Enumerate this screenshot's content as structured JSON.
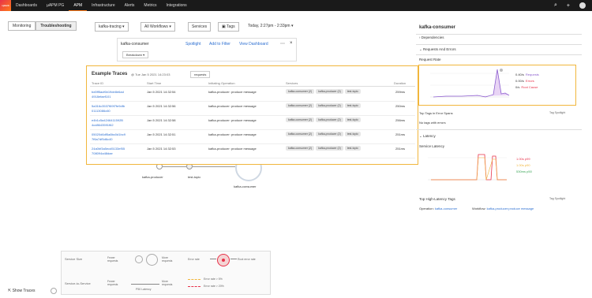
{
  "nav": {
    "logo": "splunk",
    "items": [
      "Dashboards",
      "µAPM PG",
      "APM",
      "Infrastructure",
      "Alerts",
      "Metrics",
      "Integrations"
    ],
    "active": "APM"
  },
  "toolbar": {
    "tabs": [
      "Monitoring",
      "Troubleshooting"
    ],
    "active_tab": "Troubleshooting",
    "service_filter": "kafka-tracing",
    "workflow_filter": "All Workflows",
    "services_btn": "Services",
    "tags_btn": "Tags",
    "time": "Today, 2:27pm - 2:33pm"
  },
  "service_panel": {
    "name": "kafka-consumer",
    "breakdown": "Breakdown",
    "links": [
      "Spotlight",
      "Add to Filter",
      "View Dashboard"
    ]
  },
  "traces": {
    "title": "Example Traces",
    "timestamp": "@ Tue Jan 5 2021 14:23:03",
    "requests_btn": "requests",
    "columns": [
      "Trace ID",
      "Start Time",
      "Initiating Operation",
      "Services",
      "Duration"
    ],
    "rows": [
      {
        "id1": "bd0ff5acf6b19de8e6ad",
        "id2": "4918efaef101",
        "start": "Jan 5 2021 14:32:54",
        "op": "kafka-producer: produce message",
        "dur": "259ms"
      },
      {
        "id1": "5a316c3537f69f7fe9dfb",
        "id2": "01113086c60",
        "start": "Jan 5 2021 14:32:56",
        "op": "kafka-producer: produce message",
        "dur": "250ms"
      },
      {
        "id1": "e4b1c5a4246411592B",
        "id2": "4cd8643591f62",
        "start": "Jan 5 2021 14:32:58",
        "op": "kafka-producer: produce message",
        "dur": "256ms"
      },
      {
        "id1": "05020d6df5a8bc0d1bc9",
        "id2": "7f6a7df5d6c40",
        "start": "Jan 5 2021 14:32:51",
        "op": "kafka-producer: produce message",
        "dur": "251ms"
      },
      {
        "id1": "24a0bf3a5ecd5133ef55",
        "id2": "708094a48dae",
        "start": "Jan 5 2021 14:32:53",
        "op": "kafka-producer: produce message",
        "dur": "251ms"
      }
    ],
    "services": [
      "kafka-consumer (2)",
      "kafka-producer (2)",
      "test-topic"
    ]
  },
  "map": {
    "nodes": [
      "kafka-producer",
      "test-topic",
      "kafka-consumer"
    ],
    "edge_label": "1/sec"
  },
  "right": {
    "title": "kafka-consumer",
    "sections": [
      "Dependencies",
      "Requests And Errors"
    ],
    "request_rate": "Request Rate",
    "rr_legend": [
      {
        "v": "0.40/s",
        "l": "Requests"
      },
      {
        "v": "0.00/s",
        "l": "Errors"
      },
      {
        "v": "0/s",
        "l": "Root Cause"
      }
    ],
    "rr_legend_colors": [
      "#8c5ecf",
      "#e8324a",
      "#e8324a"
    ],
    "top_tags_err": "Top Tags in Error Spans",
    "no_tags": "No tags with errors",
    "tag_spotlight": "Tag Spotlight",
    "latency_section": "Latency",
    "service_latency": "Service Latency",
    "lat_legend": [
      "1.00s p99",
      "1.00s p90",
      "530ms p50"
    ],
    "lat_legend_colors": [
      "#e8324a",
      "#f1b63c",
      "#3aa556"
    ],
    "top_lat": "Top High-Latency Tags",
    "op_label": "Operation:",
    "op_val": "kafka-consumer",
    "wf_label": "Workflow:",
    "wf_val": "kafka-producer:produce message"
  },
  "legend_box": {
    "service_size": "Service Size",
    "fewer": "Fewer requests",
    "more": "More requests",
    "error_rate": "Error rate",
    "root_error": "Root error rate",
    "dep_size": "Service-to-Service",
    "p50": "P50 Latency",
    "err5": "Error rate > 5%",
    "err20": "Error rate > 20%"
  },
  "bottom": {
    "show_traces": "Show Traces"
  }
}
